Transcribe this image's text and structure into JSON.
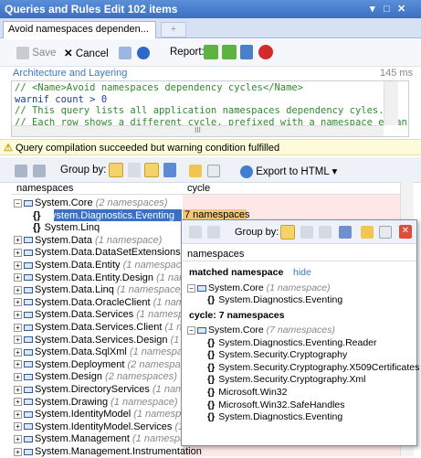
{
  "window": {
    "title": "Queries and Rules Edit",
    "count": "102 items",
    "controls": [
      "▾",
      "□",
      "✕"
    ]
  },
  "tabs": {
    "active": "Avoid namespaces dependen...",
    "new_symbol": "+"
  },
  "toolbar": {
    "save": "Save",
    "cancel": "Cancel",
    "report_label": "Report:"
  },
  "group": {
    "category": "Architecture and Layering",
    "time": "145 ms"
  },
  "editor": {
    "lines": [
      "// <Name>Avoid namespaces dependency cycles</Name>",
      "warnif count > 0",
      "// This query lists all application namespaces dependency cyles.",
      "// Each row shows a different cycle, prefixed with a namespace entan"
    ],
    "scroll_glyph": "III"
  },
  "warning": "Query compilation succeeded but warning condition fulfilled",
  "results": {
    "group_by": "Group by:",
    "export": "Export to HTML",
    "columns": [
      "namespaces",
      "cycle"
    ],
    "rows": [
      {
        "name": "System.Core",
        "extra": "(2 namespaces)",
        "level": 0,
        "pm": "−"
      },
      {
        "name": "System.Diagnostics.Eventing",
        "extra": "",
        "level": 2,
        "pm": ""
      },
      {
        "name": "System.Linq",
        "extra": "",
        "level": 2,
        "pm": ""
      },
      {
        "name": "System.Data",
        "extra": "(1 namespace)",
        "level": 0,
        "pm": "+"
      },
      {
        "name": "System.Data.DataSetExtensions",
        "extra": "(1",
        "level": 0,
        "pm": "+"
      },
      {
        "name": "System.Data.Entity",
        "extra": "(1 namespace)",
        "level": 0,
        "pm": "+"
      },
      {
        "name": "System.Data.Entity.Design",
        "extra": "(1 names",
        "level": 0,
        "pm": "+"
      },
      {
        "name": "System.Data.Linq",
        "extra": "(1 namespace)",
        "level": 0,
        "pm": "+"
      },
      {
        "name": "System.Data.OracleClient",
        "extra": "(1 namesp",
        "level": 0,
        "pm": "+"
      },
      {
        "name": "System.Data.Services",
        "extra": "(1 namespac",
        "level": 0,
        "pm": "+"
      },
      {
        "name": "System.Data.Services.Client",
        "extra": "(1 nam",
        "level": 0,
        "pm": "+"
      },
      {
        "name": "System.Data.Services.Design",
        "extra": "(1 nam",
        "level": 0,
        "pm": "+"
      },
      {
        "name": "System.Data.SqlXml",
        "extra": "(1 namespace",
        "level": 0,
        "pm": "+"
      },
      {
        "name": "System.Deployment",
        "extra": "(2 namespaces",
        "level": 0,
        "pm": "+"
      },
      {
        "name": "System.Design",
        "extra": "(2 namespaces)",
        "level": 0,
        "pm": "+"
      },
      {
        "name": "System.DirectoryServices",
        "extra": "(1 names",
        "level": 0,
        "pm": "+"
      },
      {
        "name": "System.Drawing",
        "extra": "(1 namespace)",
        "level": 0,
        "pm": "+"
      },
      {
        "name": "System.IdentityModel",
        "extra": "(1 namespac",
        "level": 0,
        "pm": "+"
      },
      {
        "name": "System.IdentityModel.Services",
        "extra": "(1 n",
        "level": 0,
        "pm": "+"
      },
      {
        "name": "System.Management",
        "extra": "(1 namespac",
        "level": 0,
        "pm": "+"
      },
      {
        "name": "System.Management.Instrumentation",
        "extra": "",
        "level": 0,
        "pm": "+"
      }
    ],
    "cycle_cell": "7 namespaces"
  },
  "popup": {
    "column": "namespaces",
    "matched_label": "matched namespace",
    "hide": "hide",
    "group_by": "Group by:",
    "matched": [
      {
        "name": "System.Core",
        "extra": "(1 namespace)",
        "pm": "−"
      },
      {
        "name": "System.Diagnostics.Eventing",
        "extra": "",
        "pm": ""
      }
    ],
    "cycle_label": "cycle: 7 namespaces",
    "cycle": [
      {
        "name": "System.Core",
        "extra": "(7 namespaces)",
        "pm": "−"
      },
      {
        "name": "System.Diagnostics.Eventing.Reader",
        "extra": "",
        "pm": ""
      },
      {
        "name": "System.Security.Cryptography",
        "extra": "",
        "pm": ""
      },
      {
        "name": "System.Security.Cryptography.X509Certificates",
        "extra": "",
        "pm": ""
      },
      {
        "name": "System.Security.Cryptography.Xml",
        "extra": "",
        "pm": ""
      },
      {
        "name": "Microsoft.Win32",
        "extra": "",
        "pm": ""
      },
      {
        "name": "Microsoft.Win32.SafeHandles",
        "extra": "",
        "pm": ""
      },
      {
        "name": "System.Diagnostics.Eventing",
        "extra": "",
        "pm": ""
      }
    ]
  }
}
